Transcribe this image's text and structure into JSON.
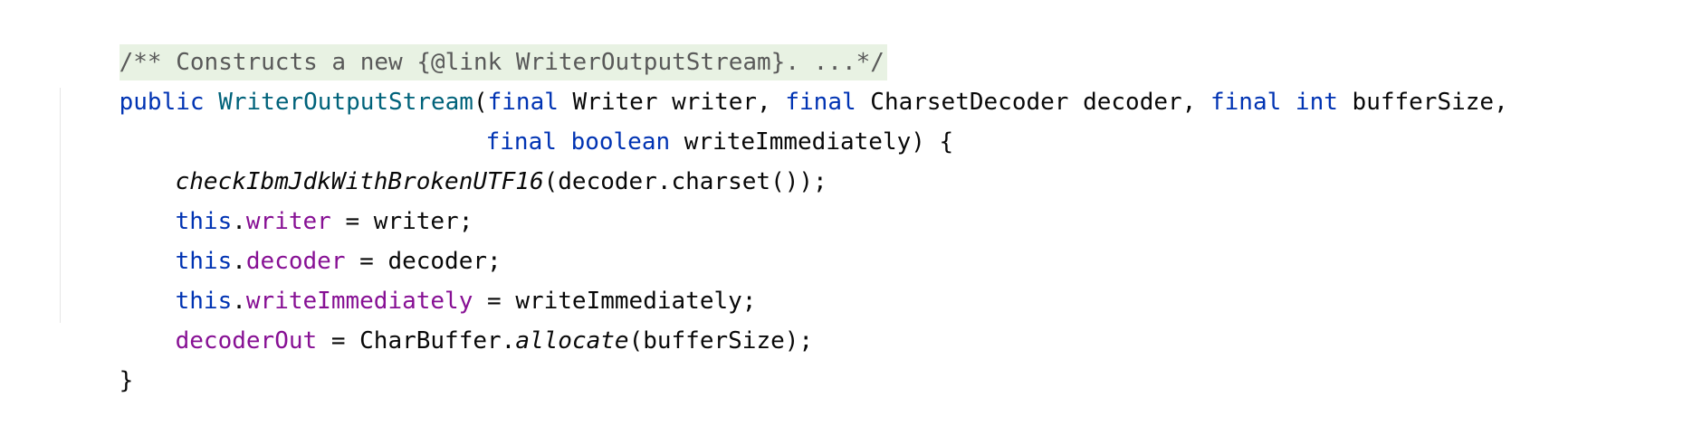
{
  "editor": {
    "doc_comment": "/** Constructs a new {@link WriterOutputStream}. ...*/",
    "line2": {
      "kw_public": "public",
      "constructor_name": "WriterOutputStream",
      "paren_open": "(",
      "kw_final1": "final",
      "param1": " Writer writer, ",
      "kw_final2": "final",
      "param2": " CharsetDecoder decoder, ",
      "kw_final3": "final",
      "kw_int": "int",
      "param3": " bufferSize,"
    },
    "line3": {
      "kw_final": "final",
      "kw_boolean": "boolean",
      "param": " writeImmediately) {"
    },
    "line4": {
      "call": "checkIbmJdkWithBrokenUTF16",
      "rest": "(decoder.charset());"
    },
    "line5": {
      "kw_this": "this",
      "dot": ".",
      "field": "writer",
      "rest": " = writer;"
    },
    "line6": {
      "kw_this": "this",
      "dot": ".",
      "field": "decoder",
      "rest": " = decoder;"
    },
    "line7": {
      "kw_this": "this",
      "dot": ".",
      "field": "writeImmediately",
      "rest": " = writeImmediately;"
    },
    "line8": {
      "field": "decoderOut",
      "mid": " = CharBuffer.",
      "static_call": "allocate",
      "rest": "(bufferSize);"
    },
    "line9": {
      "brace": "}"
    }
  },
  "colors": {
    "keyword": "#0033b3",
    "declaration": "#00627a",
    "field": "#871094",
    "doc_fold_bg": "#e8f2e3",
    "doc_text": "#595959"
  }
}
